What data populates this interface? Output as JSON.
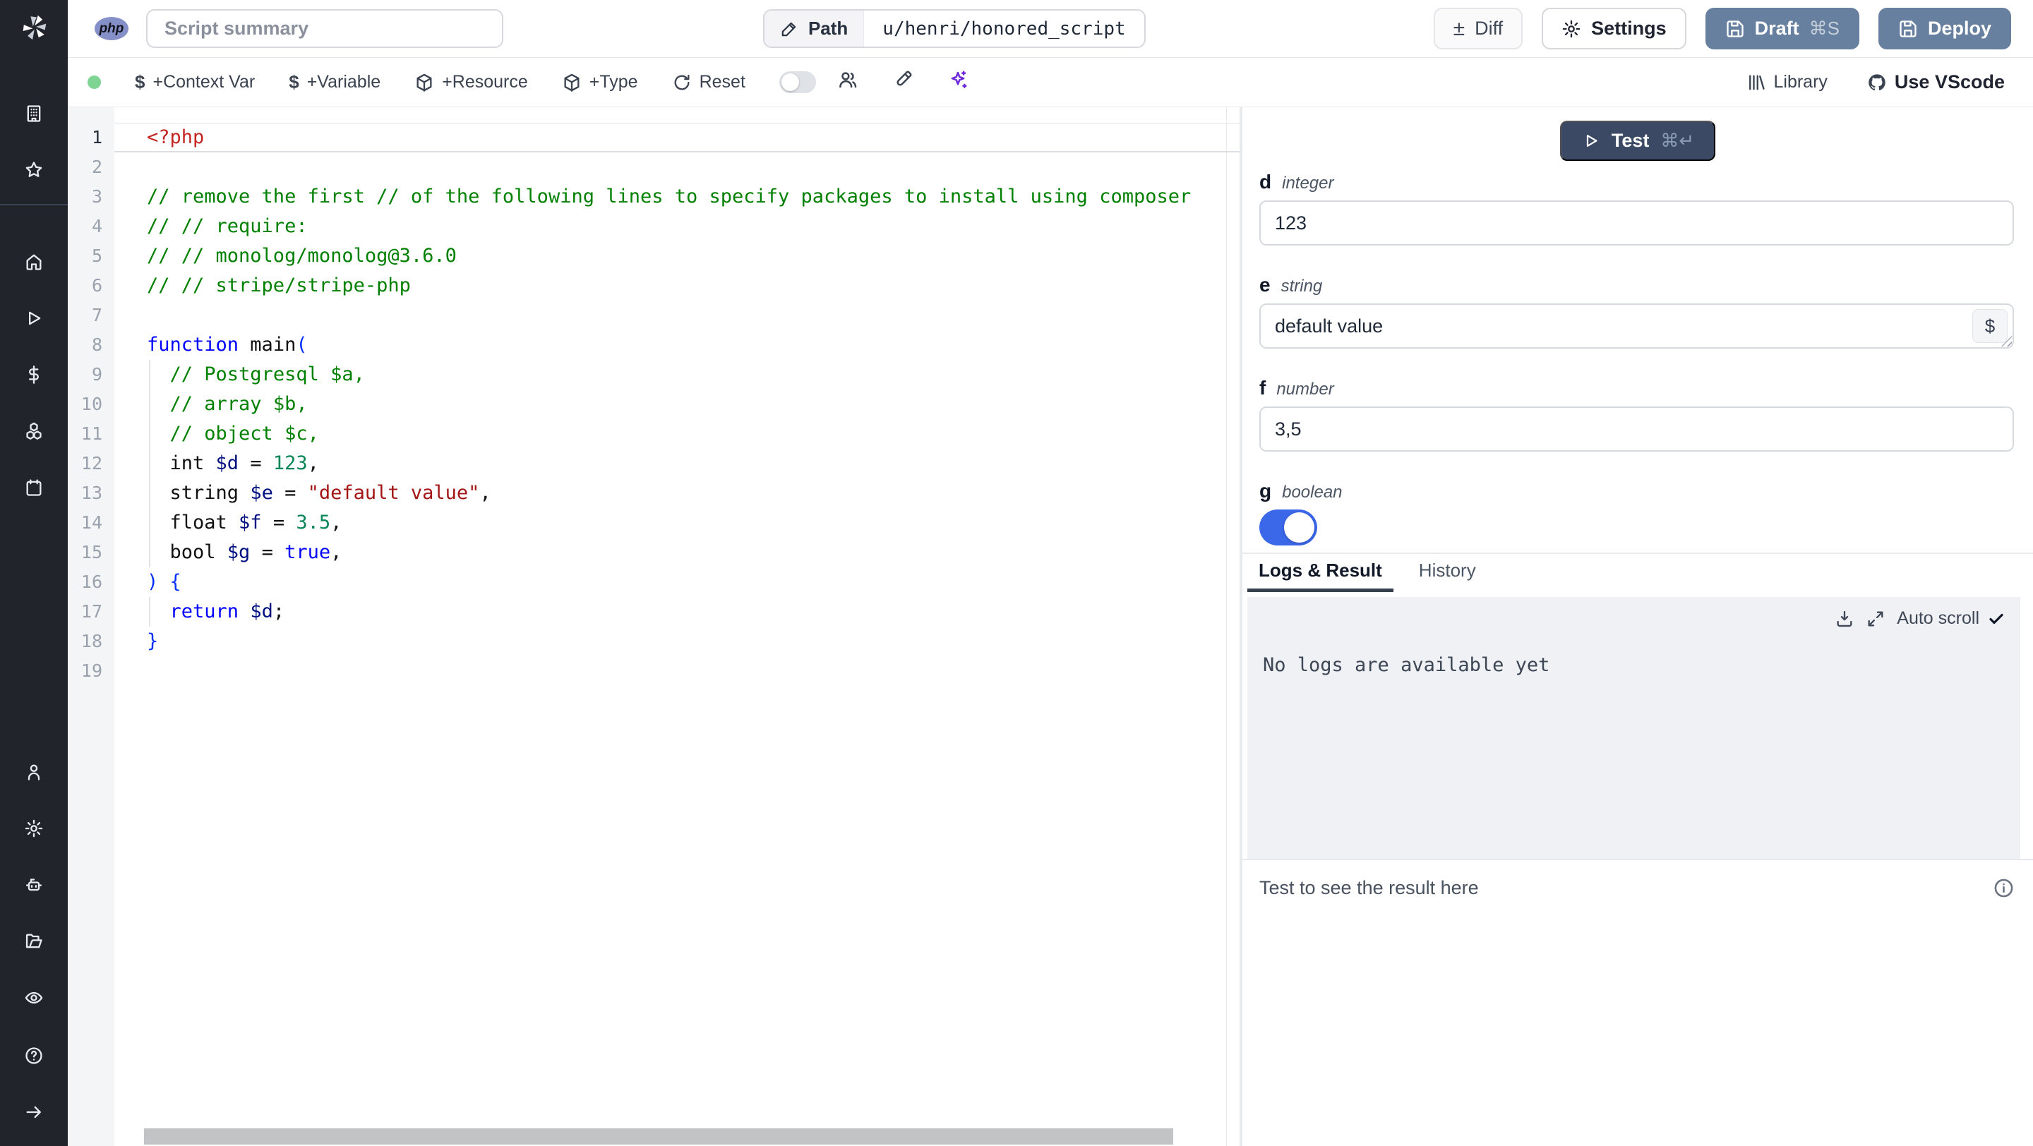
{
  "colors": {
    "sidebar_bg": "#21242b",
    "accent": "#3b67e9",
    "deploy_bg": "#67809f",
    "test_bg": "#3b4964",
    "status_green": "#7ed492",
    "ai_purple": "#6d28d9"
  },
  "icons": {
    "dollar": "$",
    "plus_minus": "±"
  },
  "sidebar": {
    "top_icons": [
      "building",
      "star"
    ],
    "main_icons": [
      "home",
      "play",
      "dollar-sign",
      "cubes",
      "calendar"
    ],
    "account_icons": [
      "user",
      "gear",
      "robot",
      "folder",
      "eye"
    ],
    "footer_icons": [
      "help",
      "arrow-right"
    ]
  },
  "topbar": {
    "language_badge": "php",
    "summary_placeholder": "Script summary",
    "path_label": "Path",
    "path_value": "u/henri/honored_script",
    "diff": "Diff",
    "settings": "Settings",
    "draft": "Draft",
    "draft_shortcut": "⌘S",
    "deploy": "Deploy"
  },
  "toolbar": {
    "add_context_var": "+Context Var",
    "add_variable": "+Variable",
    "add_resource": "+Resource",
    "add_type": "+Type",
    "reset": "Reset",
    "library": "Library",
    "use_vscode": "Use VScode"
  },
  "editor": {
    "language": "php",
    "lines": [
      {
        "n": "1",
        "active": true,
        "seg": [
          [
            "<?php",
            "tag"
          ]
        ]
      },
      {
        "n": "2",
        "seg": []
      },
      {
        "n": "3",
        "seg": [
          [
            "// remove the first // of the following lines to specify packages to install using composer",
            "comment"
          ]
        ]
      },
      {
        "n": "4",
        "seg": [
          [
            "// // require:",
            "comment"
          ]
        ]
      },
      {
        "n": "5",
        "seg": [
          [
            "// // monolog/monolog@3.6.0",
            "comment"
          ]
        ]
      },
      {
        "n": "6",
        "seg": [
          [
            "// // stripe/stripe-php",
            "comment"
          ]
        ]
      },
      {
        "n": "7",
        "seg": []
      },
      {
        "n": "8",
        "seg": [
          [
            "function",
            "keyword"
          ],
          [
            " main",
            "plain"
          ],
          [
            "(",
            "bracket"
          ]
        ]
      },
      {
        "n": "9",
        "indent": true,
        "seg": [
          [
            "  ",
            "plain"
          ],
          [
            "// Postgresql $a,",
            "comment"
          ]
        ]
      },
      {
        "n": "10",
        "indent": true,
        "seg": [
          [
            "  ",
            "plain"
          ],
          [
            "// array $b,",
            "comment"
          ]
        ]
      },
      {
        "n": "11",
        "indent": true,
        "seg": [
          [
            "  ",
            "plain"
          ],
          [
            "// object $c,",
            "comment"
          ]
        ]
      },
      {
        "n": "12",
        "indent": true,
        "seg": [
          [
            "  int ",
            "plain"
          ],
          [
            "$d",
            "variable"
          ],
          [
            " = ",
            "plain"
          ],
          [
            "123",
            "number"
          ],
          [
            ",",
            "plain"
          ]
        ]
      },
      {
        "n": "13",
        "indent": true,
        "seg": [
          [
            "  string ",
            "plain"
          ],
          [
            "$e",
            "variable"
          ],
          [
            " = ",
            "plain"
          ],
          [
            "\"default value\"",
            "string"
          ],
          [
            ",",
            "plain"
          ]
        ]
      },
      {
        "n": "14",
        "indent": true,
        "seg": [
          [
            "  float ",
            "plain"
          ],
          [
            "$f",
            "variable"
          ],
          [
            " = ",
            "plain"
          ],
          [
            "3.5",
            "number"
          ],
          [
            ",",
            "plain"
          ]
        ]
      },
      {
        "n": "15",
        "indent": true,
        "seg": [
          [
            "  bool ",
            "plain"
          ],
          [
            "$g",
            "variable"
          ],
          [
            " = ",
            "plain"
          ],
          [
            "true",
            "keyword"
          ],
          [
            ",",
            "plain"
          ]
        ]
      },
      {
        "n": "16",
        "seg": [
          [
            ") {",
            "bracket"
          ]
        ]
      },
      {
        "n": "17",
        "indent": true,
        "seg": [
          [
            "  ",
            "plain"
          ],
          [
            "return",
            "keyword"
          ],
          [
            " ",
            "plain"
          ],
          [
            "$d",
            "variable"
          ],
          [
            ";",
            "plain"
          ]
        ]
      },
      {
        "n": "18",
        "seg": [
          [
            "}",
            "bracket"
          ]
        ]
      },
      {
        "n": "19",
        "seg": []
      }
    ]
  },
  "right_panel": {
    "test": "Test",
    "test_shortcut": "⌘↵",
    "fields": [
      {
        "name": "d",
        "type": "integer",
        "kind": "input",
        "value": "123"
      },
      {
        "name": "e",
        "type": "string",
        "kind": "textarea",
        "value": "default value",
        "var_button": "$"
      },
      {
        "name": "f",
        "type": "number",
        "kind": "input",
        "value": "3,5"
      },
      {
        "name": "g",
        "type": "boolean",
        "kind": "toggle",
        "value": true
      }
    ],
    "tabs": [
      {
        "label": "Logs & Result",
        "active": true
      },
      {
        "label": "History",
        "active": false
      }
    ],
    "auto_scroll": "Auto scroll",
    "no_logs": "No logs are available yet",
    "result_placeholder": "Test to see the result here"
  }
}
